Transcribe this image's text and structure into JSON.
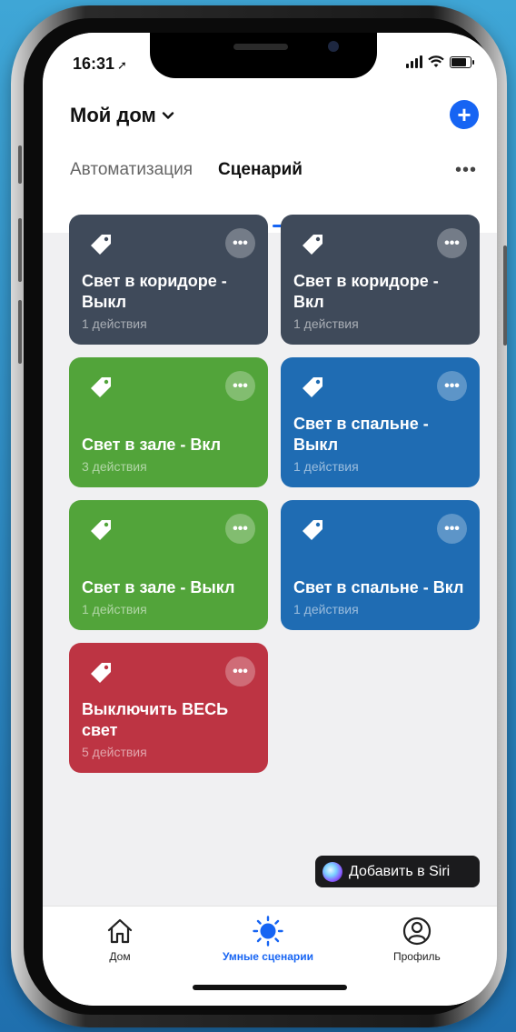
{
  "status_bar": {
    "time": "16:31",
    "location_arrow": "location-arrow-icon"
  },
  "header": {
    "title": "Мой дом",
    "add_icon": "plus-icon",
    "add_symbol": "+"
  },
  "tabs": [
    {
      "label": "Автоматизация",
      "active": false
    },
    {
      "label": "Сценарий",
      "active": true
    }
  ],
  "more_label": "•••",
  "scenes": [
    {
      "name": "Свет в коридоре - Выкл",
      "actions": "1 действия",
      "color": "#3f4a5a"
    },
    {
      "name": "Свет в коридоре - Вкл",
      "actions": "1 действия",
      "color": "#3f4a5a"
    },
    {
      "name": "Свет в зале - Вкл",
      "actions": "3 действия",
      "color": "#52a43a"
    },
    {
      "name": "Свет в спальне - Выкл",
      "actions": "1 действия",
      "color": "#1f6cb3"
    },
    {
      "name": "Свет в зале - Выкл",
      "actions": "1 действия",
      "color": "#52a43a"
    },
    {
      "name": "Свет в спальне - Вкл",
      "actions": "1 действия",
      "color": "#1f6cb3"
    },
    {
      "name": "Выключить ВЕСЬ свет",
      "actions": "5 действия",
      "color": "#bd3443"
    }
  ],
  "card_more_label": "•••",
  "siri_button": {
    "label": "Добавить в Siri"
  },
  "tabbar": [
    {
      "label": "Дом",
      "icon": "home-icon",
      "active": false
    },
    {
      "label": "Умные сценарии",
      "icon": "sun-icon",
      "active": true
    },
    {
      "label": "Профиль",
      "icon": "profile-icon",
      "active": false
    }
  ],
  "colors": {
    "accent": "#1664f3",
    "gray_card": "#3f4a5a",
    "green_card": "#52a43a",
    "blue_card": "#1f6cb3",
    "red_card": "#bd3443"
  }
}
